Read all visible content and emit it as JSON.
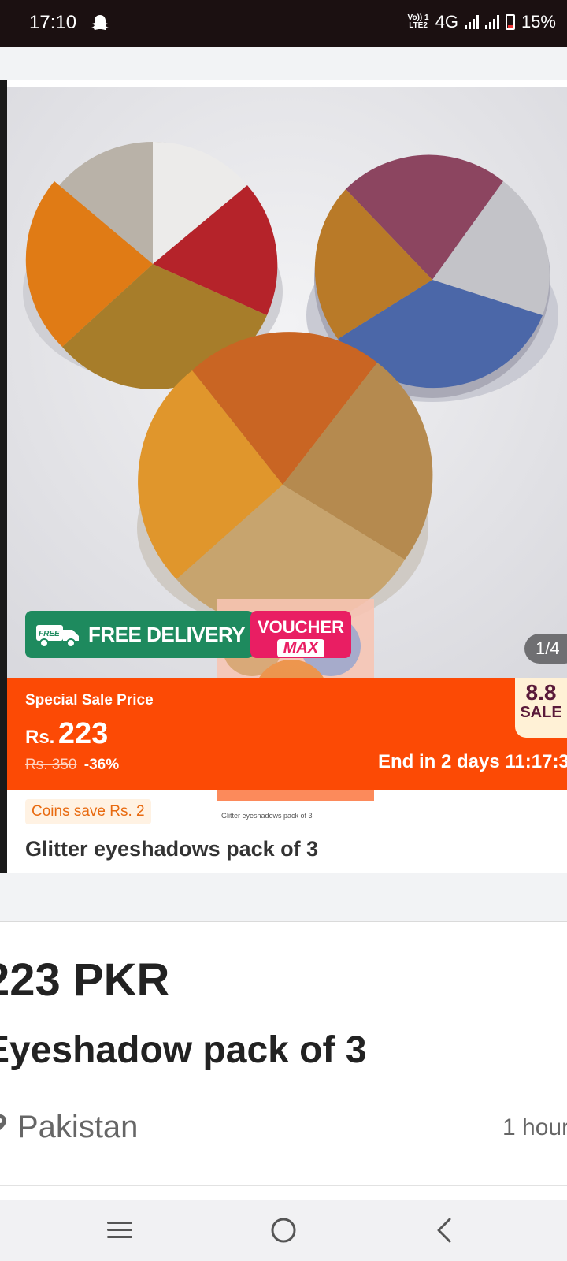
{
  "status_bar": {
    "time": "17:10",
    "network_label_top": "Vo)) 1",
    "network_label_bottom": "LTE2",
    "network_type": "4G",
    "battery_percent": "15%",
    "battery_level": 0.15
  },
  "product_image": {
    "counter": "1/4",
    "free_delivery_badge": "FREE",
    "free_delivery_label": "FREE DELIVERY",
    "voucher_line1": "VOUCHER",
    "voucher_line2": "MAX"
  },
  "sale": {
    "special_label": "Special Sale Price",
    "currency": "Rs.",
    "price": "223",
    "old_price": "Rs. 350",
    "discount": "-36%",
    "end_in": "End in 2 days 11:17:3",
    "badge_top": "8.8",
    "badge_bottom": "SALE"
  },
  "coins_label": "Coins save Rs. 2",
  "product_title": "Glitter eyeshadows pack of 3",
  "listing": {
    "price": "223 PKR",
    "title": "Eyeshadow pack of 3",
    "location": "Pakistan",
    "posted": "1 hour"
  },
  "colors": {
    "sale_orange": "#fc4a05",
    "delivery_green": "#1e8a5e",
    "voucher_pink": "#e91e63",
    "status_bar": "#1b1011"
  }
}
